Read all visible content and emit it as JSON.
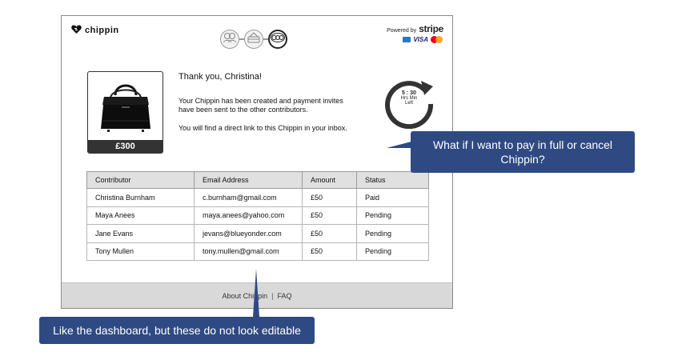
{
  "header": {
    "logo_text": "chippin",
    "powered_by_label": "Powered by",
    "stripe_label": "stripe",
    "card_visa_label": "VISA",
    "steps": [
      {
        "icon": "people-icon",
        "active": false
      },
      {
        "icon": "card-payment-icon",
        "active": false
      },
      {
        "icon": "coins-icon",
        "active": true
      }
    ]
  },
  "product": {
    "icon": "handbag-image",
    "price": "£300"
  },
  "confirmation": {
    "title": "Thank you, Christina!",
    "message_line_1": "Your Chippin has been created and payment invites",
    "message_line_2": "have been sent to the other contributors.",
    "inbox_note": "You will find a direct link to this Chippin in your inbox."
  },
  "timer": {
    "count": "5 : 30",
    "units": "Hrs   Min",
    "left_label": "Left"
  },
  "table": {
    "headers": [
      "Contributor",
      "Email Address",
      "Amount",
      "Status"
    ],
    "rows": [
      {
        "contributor": "Christina Burnham",
        "email": "c.burnham@gmail.com",
        "amount": "£50",
        "status": "Paid"
      },
      {
        "contributor": "Maya Anees",
        "email": "maya.anees@yahoo.com",
        "amount": "£50",
        "status": "Pending"
      },
      {
        "contributor": "Jane Evans",
        "email": "jevans@blueyonder.com",
        "amount": "£50",
        "status": "Pending"
      },
      {
        "contributor": "Tony Mullen",
        "email": "tony.mullen@gmail.com",
        "amount": "£50",
        "status": "Pending"
      }
    ]
  },
  "footer": {
    "about_link": "About Chippin",
    "separator": "|",
    "faq_link": "FAQ"
  },
  "annotations": {
    "right_line_1": "What if I want to pay in full or cancel",
    "right_line_2": "Chippin?",
    "bottom": "Like the dashboard, but these do not look editable"
  },
  "colors": {
    "callout": "#2f4a82",
    "footer": "#d9d9d9",
    "table_header": "#e0e0e0",
    "price_bar": "#333333"
  }
}
